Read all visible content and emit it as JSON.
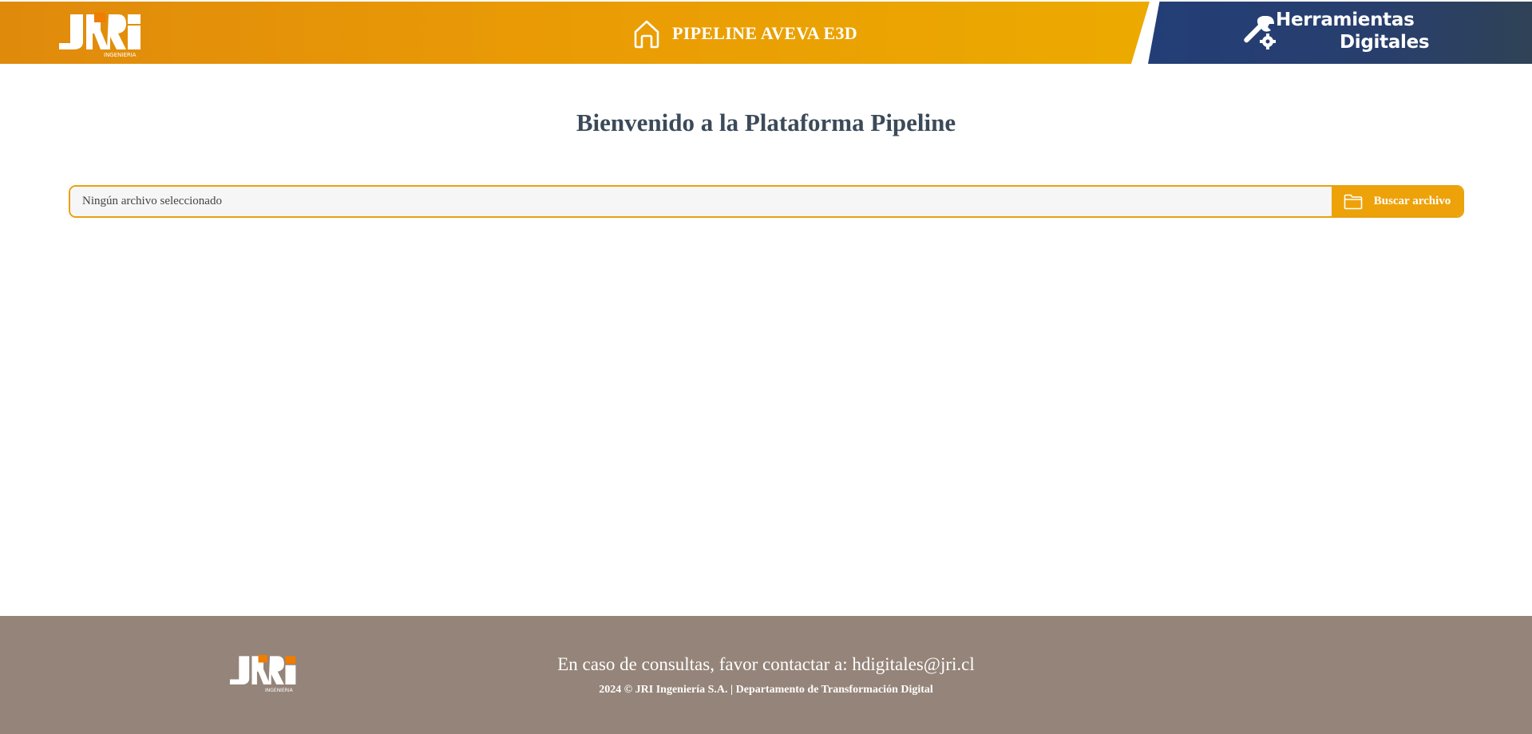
{
  "header": {
    "logo_text": "JRI",
    "logo_subtext": "INGENIERIA",
    "home_icon": "home-icon",
    "title": "PIPELINE AVEVA E3D",
    "brand_line1": "Herramientas",
    "brand_line2": "Digitales",
    "brand_icon": "wrench-gear-icon"
  },
  "main": {
    "welcome": "Bienvenido a la Plataforma Pipeline",
    "file_picker": {
      "status_text": "Ningún archivo seleccionado",
      "button_label": "Buscar archivo",
      "button_icon": "folder-icon"
    }
  },
  "footer": {
    "contact": "En caso de consultas, favor contactar a: hdigitales@jri.cl",
    "copyright": "2024 © JRI Ingeniería S.A. | Departamento de Transformación Digital"
  },
  "colors": {
    "header_orange": "#e99a05",
    "header_blue": "#283f6d",
    "accent": "#eea20a",
    "title_text": "#3b4a59",
    "footer_bg": "#958479",
    "logo_square": "#f07c00"
  }
}
